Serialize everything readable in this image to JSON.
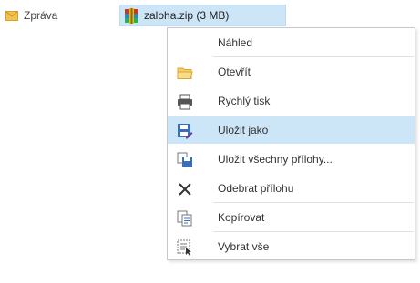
{
  "message_tab": {
    "icon": "envelope-icon",
    "label": "Zpráva"
  },
  "attachment": {
    "icon": "winrar-archive-icon",
    "label": "zaloha.zip (3 MB)"
  },
  "menu": {
    "items": [
      {
        "label": "Náhled",
        "icon": ""
      },
      {
        "label": "Otevřít",
        "icon": "folder-open-icon"
      },
      {
        "label": "Rychlý tisk",
        "icon": "printer-icon"
      },
      {
        "label": "Uložit jako",
        "icon": "save-as-icon",
        "highlighted": true
      },
      {
        "label": "Uložit všechny přílohy...",
        "icon": "save-all-icon"
      },
      {
        "label": "Odebrat přílohu",
        "icon": "remove-x-icon"
      },
      {
        "label": "Kopírovat",
        "icon": "copy-icon"
      },
      {
        "label": "Vybrat vše",
        "icon": "select-all-icon"
      }
    ]
  },
  "colors": {
    "highlight": "#cde6f7",
    "accent": "#3a6fb8"
  }
}
